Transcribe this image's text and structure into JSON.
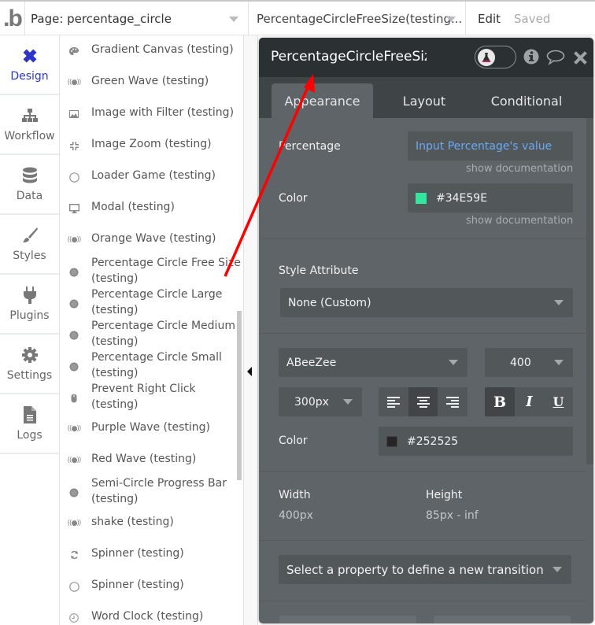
{
  "topbar": {
    "logo": ".b",
    "page_selector": "Page: percentage_circle",
    "element_selector": "PercentageCircleFreeSize(testing...",
    "edit_label": "Edit",
    "saved_label": "Saved"
  },
  "nav": {
    "items": [
      {
        "label": "Design",
        "icon": "design-pencil-ruler-icon",
        "active": true
      },
      {
        "label": "Workflow",
        "icon": "workflow-sitemap-icon",
        "active": false
      },
      {
        "label": "Data",
        "icon": "database-icon",
        "active": false
      },
      {
        "label": "Styles",
        "icon": "brush-icon",
        "active": false
      },
      {
        "label": "Plugins",
        "icon": "plug-icon",
        "active": false
      },
      {
        "label": "Settings",
        "icon": "gear-icon",
        "active": false
      },
      {
        "label": "Logs",
        "icon": "file-icon",
        "active": false
      }
    ]
  },
  "element_list": {
    "items": [
      {
        "label": "Gradient Canvas (testing)",
        "icon": "palette-icon"
      },
      {
        "label": "Green Wave (testing)",
        "icon": "broadcast-icon"
      },
      {
        "label": "Image with Filter (testing)",
        "icon": "image-icon"
      },
      {
        "label": "Image Zoom (testing)",
        "icon": "compress-icon"
      },
      {
        "label": "Loader Game (testing)",
        "icon": "circle-outline-icon"
      },
      {
        "label": "Modal (testing)",
        "icon": "monitor-icon"
      },
      {
        "label": "Orange Wave (testing)",
        "icon": "broadcast-icon"
      },
      {
        "label": "Percentage Circle Free Size (testing)",
        "icon": "filled-circle-icon"
      },
      {
        "label": "Percentage Circle Large (testing)",
        "icon": "filled-circle-icon"
      },
      {
        "label": "Percentage Circle Medium (testing)",
        "icon": "filled-circle-icon"
      },
      {
        "label": "Percentage Circle Small (testing)",
        "icon": "filled-circle-icon"
      },
      {
        "label": "Prevent Right Click (testing)",
        "icon": "mouse-icon"
      },
      {
        "label": "Purple Wave (testing)",
        "icon": "broadcast-icon"
      },
      {
        "label": "Red Wave (testing)",
        "icon": "broadcast-icon"
      },
      {
        "label": "Semi-Circle Progress Bar (testing)",
        "icon": "filled-circle-icon"
      },
      {
        "label": "shake (testing)",
        "icon": "broadcast-icon"
      },
      {
        "label": "Spinner (testing)",
        "icon": "refresh-icon"
      },
      {
        "label": "Spinner (testing)",
        "icon": "circle-outline-icon"
      },
      {
        "label": "Word Clock (testing)",
        "icon": "clock-icon"
      }
    ]
  },
  "editor": {
    "title": "PercentageCircleFreeSize",
    "tabs": [
      "Appearance",
      "Layout",
      "Conditional"
    ],
    "active_tab": "Appearance",
    "percentage": {
      "label": "Percentage",
      "placeholder": "Input Percentage's value",
      "doc_link": "show documentation"
    },
    "color": {
      "label": "Color",
      "value": "#34E59E",
      "swatch": "#34E59E",
      "doc_link": "show documentation"
    },
    "style_attribute": {
      "label": "Style Attribute",
      "value": "None (Custom)"
    },
    "font": {
      "family": "ABeeZee",
      "weight": "400",
      "size": "300px",
      "align": "center",
      "bold": true,
      "italic": false,
      "underline": false
    },
    "bold_glyph": "B",
    "italic_glyph": "I",
    "underline_glyph": "U",
    "text_color": {
      "label": "Color",
      "value": "#252525",
      "swatch": "#252525"
    },
    "width": {
      "label": "Width",
      "value": "400px"
    },
    "height": {
      "label": "Height",
      "value": "85px - inf"
    },
    "transition": {
      "placeholder": "Select a property to define a new transition"
    }
  },
  "colors": {
    "accent_nav": "#2a36c9",
    "annotation_arrow": "#ff0000"
  }
}
